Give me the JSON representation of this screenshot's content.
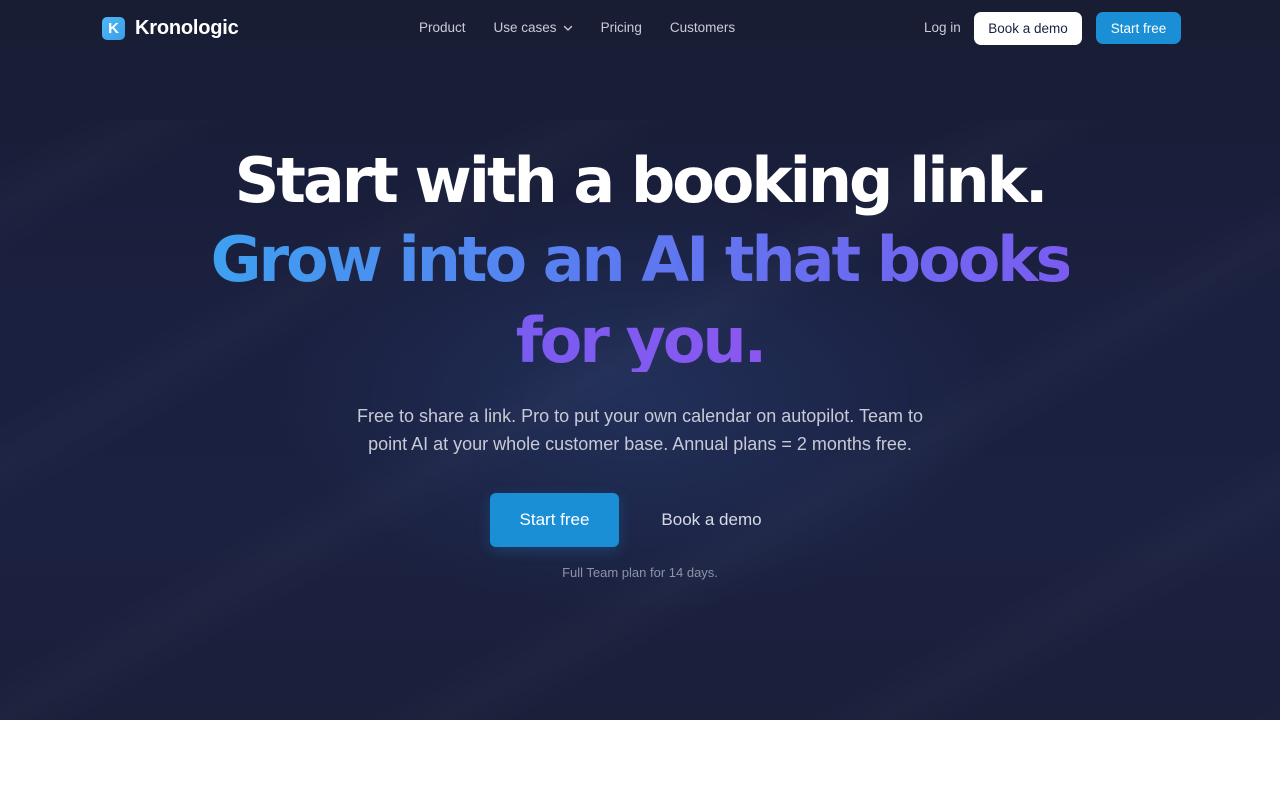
{
  "brand": {
    "logo_letter": "K",
    "name": "Kronologic"
  },
  "nav": {
    "items": [
      {
        "label": "Product"
      },
      {
        "label": "Use cases"
      },
      {
        "label": "Pricing"
      },
      {
        "label": "Customers"
      }
    ],
    "login": "Log in",
    "book_demo": "Book a demo",
    "start_free": "Start free"
  },
  "hero": {
    "line1": "Start with a booking link.",
    "line2": "Grow into an AI that books",
    "line3": "for you.",
    "subtitle": "Free to share a link. Pro to put your own calendar on autopilot. Team to point AI at your whole customer base. Annual plans = 2 months free.",
    "cta_primary": "Start free",
    "cta_secondary": "Book a demo",
    "note": "Full Team plan for 14 days."
  },
  "colors": {
    "hero_bg": "#1a2040",
    "accent": "#1a8fd6",
    "gradient_start": "#3ea0f0",
    "gradient_end": "#7a5cf0"
  }
}
